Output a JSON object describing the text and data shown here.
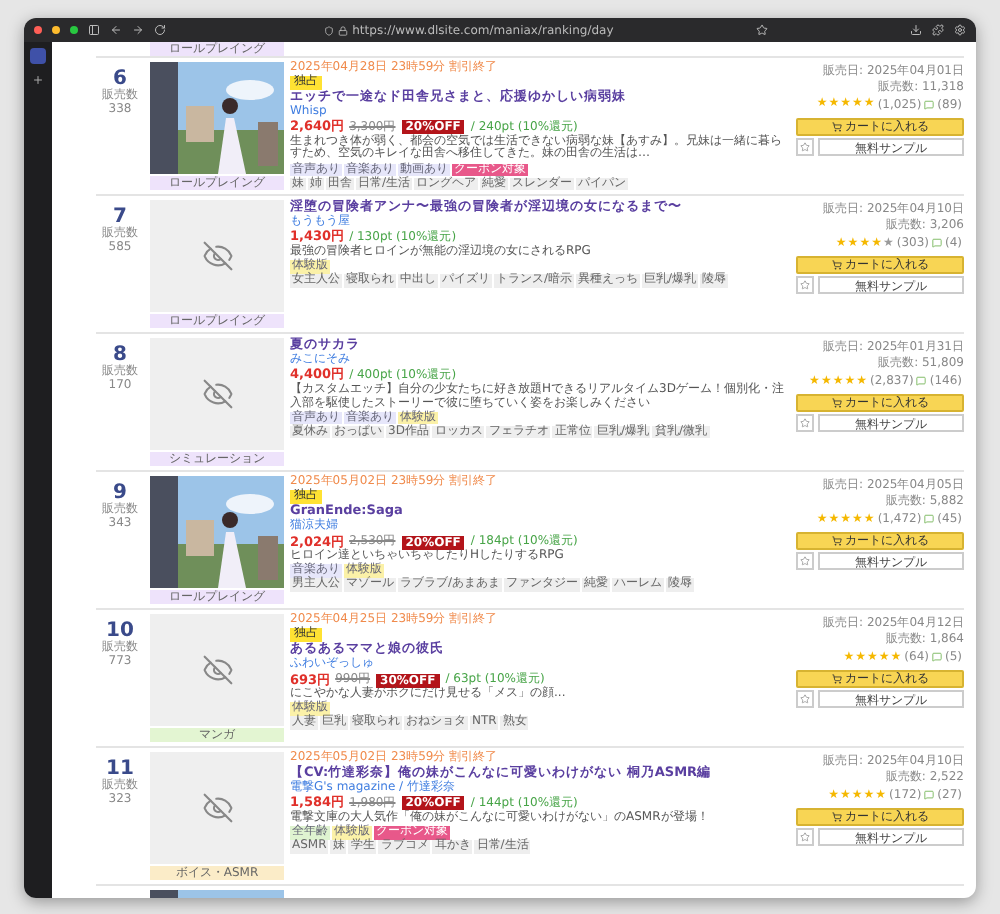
{
  "browser": {
    "url": "https://www.dlsite.com/maniax/ranking/day"
  },
  "top_category": {
    "label": "ロールプレイング",
    "color": "#eee3fb"
  },
  "items": [
    {
      "rank": "6",
      "rank_label": "販売数",
      "rank_count": "338",
      "image": true,
      "note": "2025年04月28日 23時59分 割引終了",
      "badge": "独占",
      "title": "エッチで一途なド田舎兄さまと、応援ゆかしい病弱妹",
      "circle": "Whisp",
      "price": "2,640円",
      "original_price": "3,300円",
      "discount": "20%OFF",
      "points": "/ 240pt (10%還元)",
      "description": "生まれつき体が弱く、都会の空気では生活できない病弱な妹【あすみ】。兄妹は一緒に暮らすため、空気のキレイな田舎へ移住してきた。妹の田舎の生活は…",
      "genres": [
        {
          "label": "音声あり",
          "color": "#e6e6fa"
        },
        {
          "label": "音楽あり",
          "color": "#e6e6fa"
        },
        {
          "label": "動画あり",
          "color": "#e6e6fa"
        },
        {
          "label": "クーポン対象",
          "color": "#e8588a"
        }
      ],
      "tags": [
        "妹",
        "姉",
        "田舎",
        "日常/生活",
        "ロングヘア",
        "純愛",
        "スレンダー",
        "パイパン"
      ],
      "category": {
        "label": "ロールプレイング",
        "color": "#eee3fb"
      },
      "release": "販売日: 2025年04月01日",
      "sales": "販売数: 11,318",
      "stars": 5,
      "rating_count": "(1,025)",
      "comment_count": "(89)",
      "cart_button": "カートに入れる",
      "sample_button": "無料サンプル"
    },
    {
      "rank": "7",
      "rank_label": "販売数",
      "rank_count": "585",
      "image": false,
      "title": "淫堕の冒険者アンナ〜最強の冒険者が淫辺境の女になるまで〜",
      "circle": "もうもう屋",
      "price": "1,430円",
      "points": "/ 130pt (10%還元)",
      "description": "最強の冒険者ヒロインが無能の淫辺境の女にされるRPG",
      "genres": [
        {
          "label": "体験版",
          "color": "#fbf1a8"
        }
      ],
      "tags": [
        "女主人公",
        "寝取られ",
        "中出し",
        "パイズリ",
        "トランス/暗示",
        "異種えっち",
        "巨乳/爆乳",
        "陵辱"
      ],
      "category": {
        "label": "ロールプレイング",
        "color": "#eee3fb"
      },
      "release": "販売日: 2025年04月10日",
      "sales": "販売数: 3,206",
      "stars": 4,
      "rating_count": "(303)",
      "comment_count": "(4)",
      "cart_button": "カートに入れる",
      "sample_button": "無料サンプル"
    },
    {
      "rank": "8",
      "rank_label": "販売数",
      "rank_count": "170",
      "image": false,
      "title": "夏のサカラ",
      "circle": "みこにそみ",
      "price": "4,400円",
      "points": "/ 400pt (10%還元)",
      "description": "【カスタムエッチ】自分の少女たちに好き放題Hできるリアルタイム3Dゲーム！個別化・注入部を駆使したストーリーで彼に堕ちていく姿をお楽しみください",
      "genres": [
        {
          "label": "音声あり",
          "color": "#e6e6fa"
        },
        {
          "label": "音楽あり",
          "color": "#e6e6fa"
        },
        {
          "label": "体験版",
          "color": "#fbf1a8"
        }
      ],
      "tags": [
        "夏休み",
        "おっぱい",
        "3D作品",
        "ロッカス",
        "フェラチオ",
        "正常位",
        "巨乳/爆乳",
        "貧乳/微乳"
      ],
      "category": {
        "label": "シミュレーション",
        "color": "#eee3fb"
      },
      "release": "販売日: 2025年01月31日",
      "sales": "販売数: 51,809",
      "stars": 5,
      "rating_count": "(2,837)",
      "comment_count": "(146)",
      "cart_button": "カートに入れる",
      "sample_button": "無料サンプル"
    },
    {
      "rank": "9",
      "rank_label": "販売数",
      "rank_count": "343",
      "image": true,
      "note": "2025年05月02日 23時59分 割引終了",
      "badge": "独占",
      "title": "GranEnde:Saga",
      "circle": "猫涼夫婦",
      "price": "2,024円",
      "original_price": "2,530円",
      "discount": "20%OFF",
      "points": "/ 184pt (10%還元)",
      "description": "ヒロイン達といちゃいちゃしたりHしたりするRPG",
      "genres": [
        {
          "label": "音楽あり",
          "color": "#e6e6fa"
        },
        {
          "label": "体験版",
          "color": "#fbf1a8"
        }
      ],
      "tags": [
        "男主人公",
        "マゾール",
        "ラブラブ/あまあま",
        "ファンタジー",
        "純愛",
        "ハーレム",
        "陵辱"
      ],
      "category": {
        "label": "ロールプレイング",
        "color": "#eee3fb"
      },
      "release": "販売日: 2025年04月05日",
      "sales": "販売数: 5,882",
      "stars": 5,
      "rating_count": "(1,472)",
      "comment_count": "(45)",
      "cart_button": "カートに入れる",
      "sample_button": "無料サンプル"
    },
    {
      "rank": "10",
      "rank_label": "販売数",
      "rank_count": "773",
      "image": false,
      "note": "2025年04月25日 23時59分 割引終了",
      "badge": "独占",
      "title": "あるあるママと娘の彼氏",
      "circle": "ふわいぞっしゅ",
      "price": "693円",
      "original_price": "990円",
      "discount": "30%OFF",
      "points": "/ 63pt (10%還元)",
      "description": "にこやかな人妻がボクにだけ見せる「メス」の顔...",
      "genres": [
        {
          "label": "体験版",
          "color": "#fbf1a8"
        }
      ],
      "tags": [
        "人妻",
        "巨乳",
        "寝取られ",
        "おねショタ",
        "NTR",
        "熟女"
      ],
      "category": {
        "label": "マンガ",
        "color": "#e3f5d2"
      },
      "release": "販売日: 2025年04月12日",
      "sales": "販売数: 1,864",
      "stars": 5,
      "rating_count": "(64)",
      "comment_count": "(5)",
      "cart_button": "カートに入れる",
      "sample_button": "無料サンプル"
    },
    {
      "rank": "11",
      "rank_label": "販売数",
      "rank_count": "323",
      "image": false,
      "note": "2025年05月02日 23時59分 割引終了",
      "title": "【CV:竹達彩奈】俺の妹がこんなに可愛いわけがない 桐乃ASMR編",
      "circle": "電撃G's magazine / 竹達彩奈",
      "price": "1,584円",
      "original_price": "1,980円",
      "discount": "20%OFF",
      "points": "/ 144pt (10%還元)",
      "description": "電撃文庫の大人気作「俺の妹がこんなに可愛いわけがない」のASMRが登場！",
      "genres": [
        {
          "label": "全年齢",
          "color": "#dff3d0"
        },
        {
          "label": "体験版",
          "color": "#fbf1a8"
        },
        {
          "label": "クーポン対象",
          "color": "#e8588a"
        }
      ],
      "tags": [
        "ASMR",
        "妹",
        "学生",
        "ラブコメ",
        "耳かき",
        "日常/生活"
      ],
      "category": {
        "label": "ボイス・ASMR",
        "color": "#fbecc8"
      },
      "release": "販売日: 2025年04月10日",
      "sales": "販売数: 2,522",
      "stars": 5,
      "rating_count": "(172)",
      "comment_count": "(27)",
      "cart_button": "カートに入れる",
      "sample_button": "無料サンプル"
    },
    {
      "image": true
    }
  ]
}
